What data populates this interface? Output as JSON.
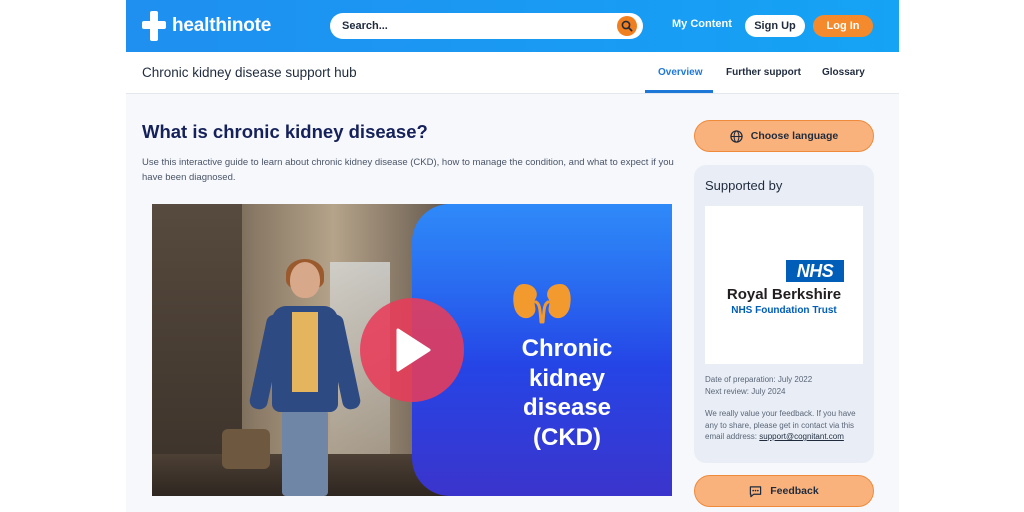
{
  "header": {
    "logo_text": "healthinote",
    "search_placeholder": "Search...",
    "my_content_label": "My Content",
    "signup_label": "Sign Up",
    "login_label": "Log In"
  },
  "subnav": {
    "hub_title": "Chronic kidney disease support hub",
    "tabs": [
      {
        "label": "Overview",
        "active": true
      },
      {
        "label": "Further support",
        "active": false
      },
      {
        "label": "Glossary",
        "active": false
      }
    ]
  },
  "main": {
    "heading": "What is chronic kidney disease?",
    "intro": "Use this interactive guide to learn about chronic kidney disease (CKD), how to manage the condition, and what to expect if you have been diagnosed.",
    "video_title": "Chronic\nkidney\ndisease\n(CKD)"
  },
  "sidebar": {
    "language_button": "Choose language",
    "supported_by": "Supported by",
    "nhs_badge": "NHS",
    "nhs_name": "Royal Berkshire",
    "nhs_trust": "NHS Foundation Trust",
    "date_prepared": "Date of preparation: July 2022",
    "next_review": "Next review: July 2024",
    "feedback_text": "We really value your feedback. If you have any to share, please get in contact via this email address:",
    "email": "support@cognitant.com",
    "feedback_button": "Feedback"
  },
  "colors": {
    "header_blue": "#1f8ff0",
    "accent_orange": "#f58a2c",
    "button_peach": "#f9b27c",
    "heading_navy": "#15215a",
    "nhs_blue": "#005eb8"
  },
  "icons": [
    "search-icon",
    "globe-icon",
    "play-icon",
    "kidneys-icon",
    "feedback-icon"
  ]
}
